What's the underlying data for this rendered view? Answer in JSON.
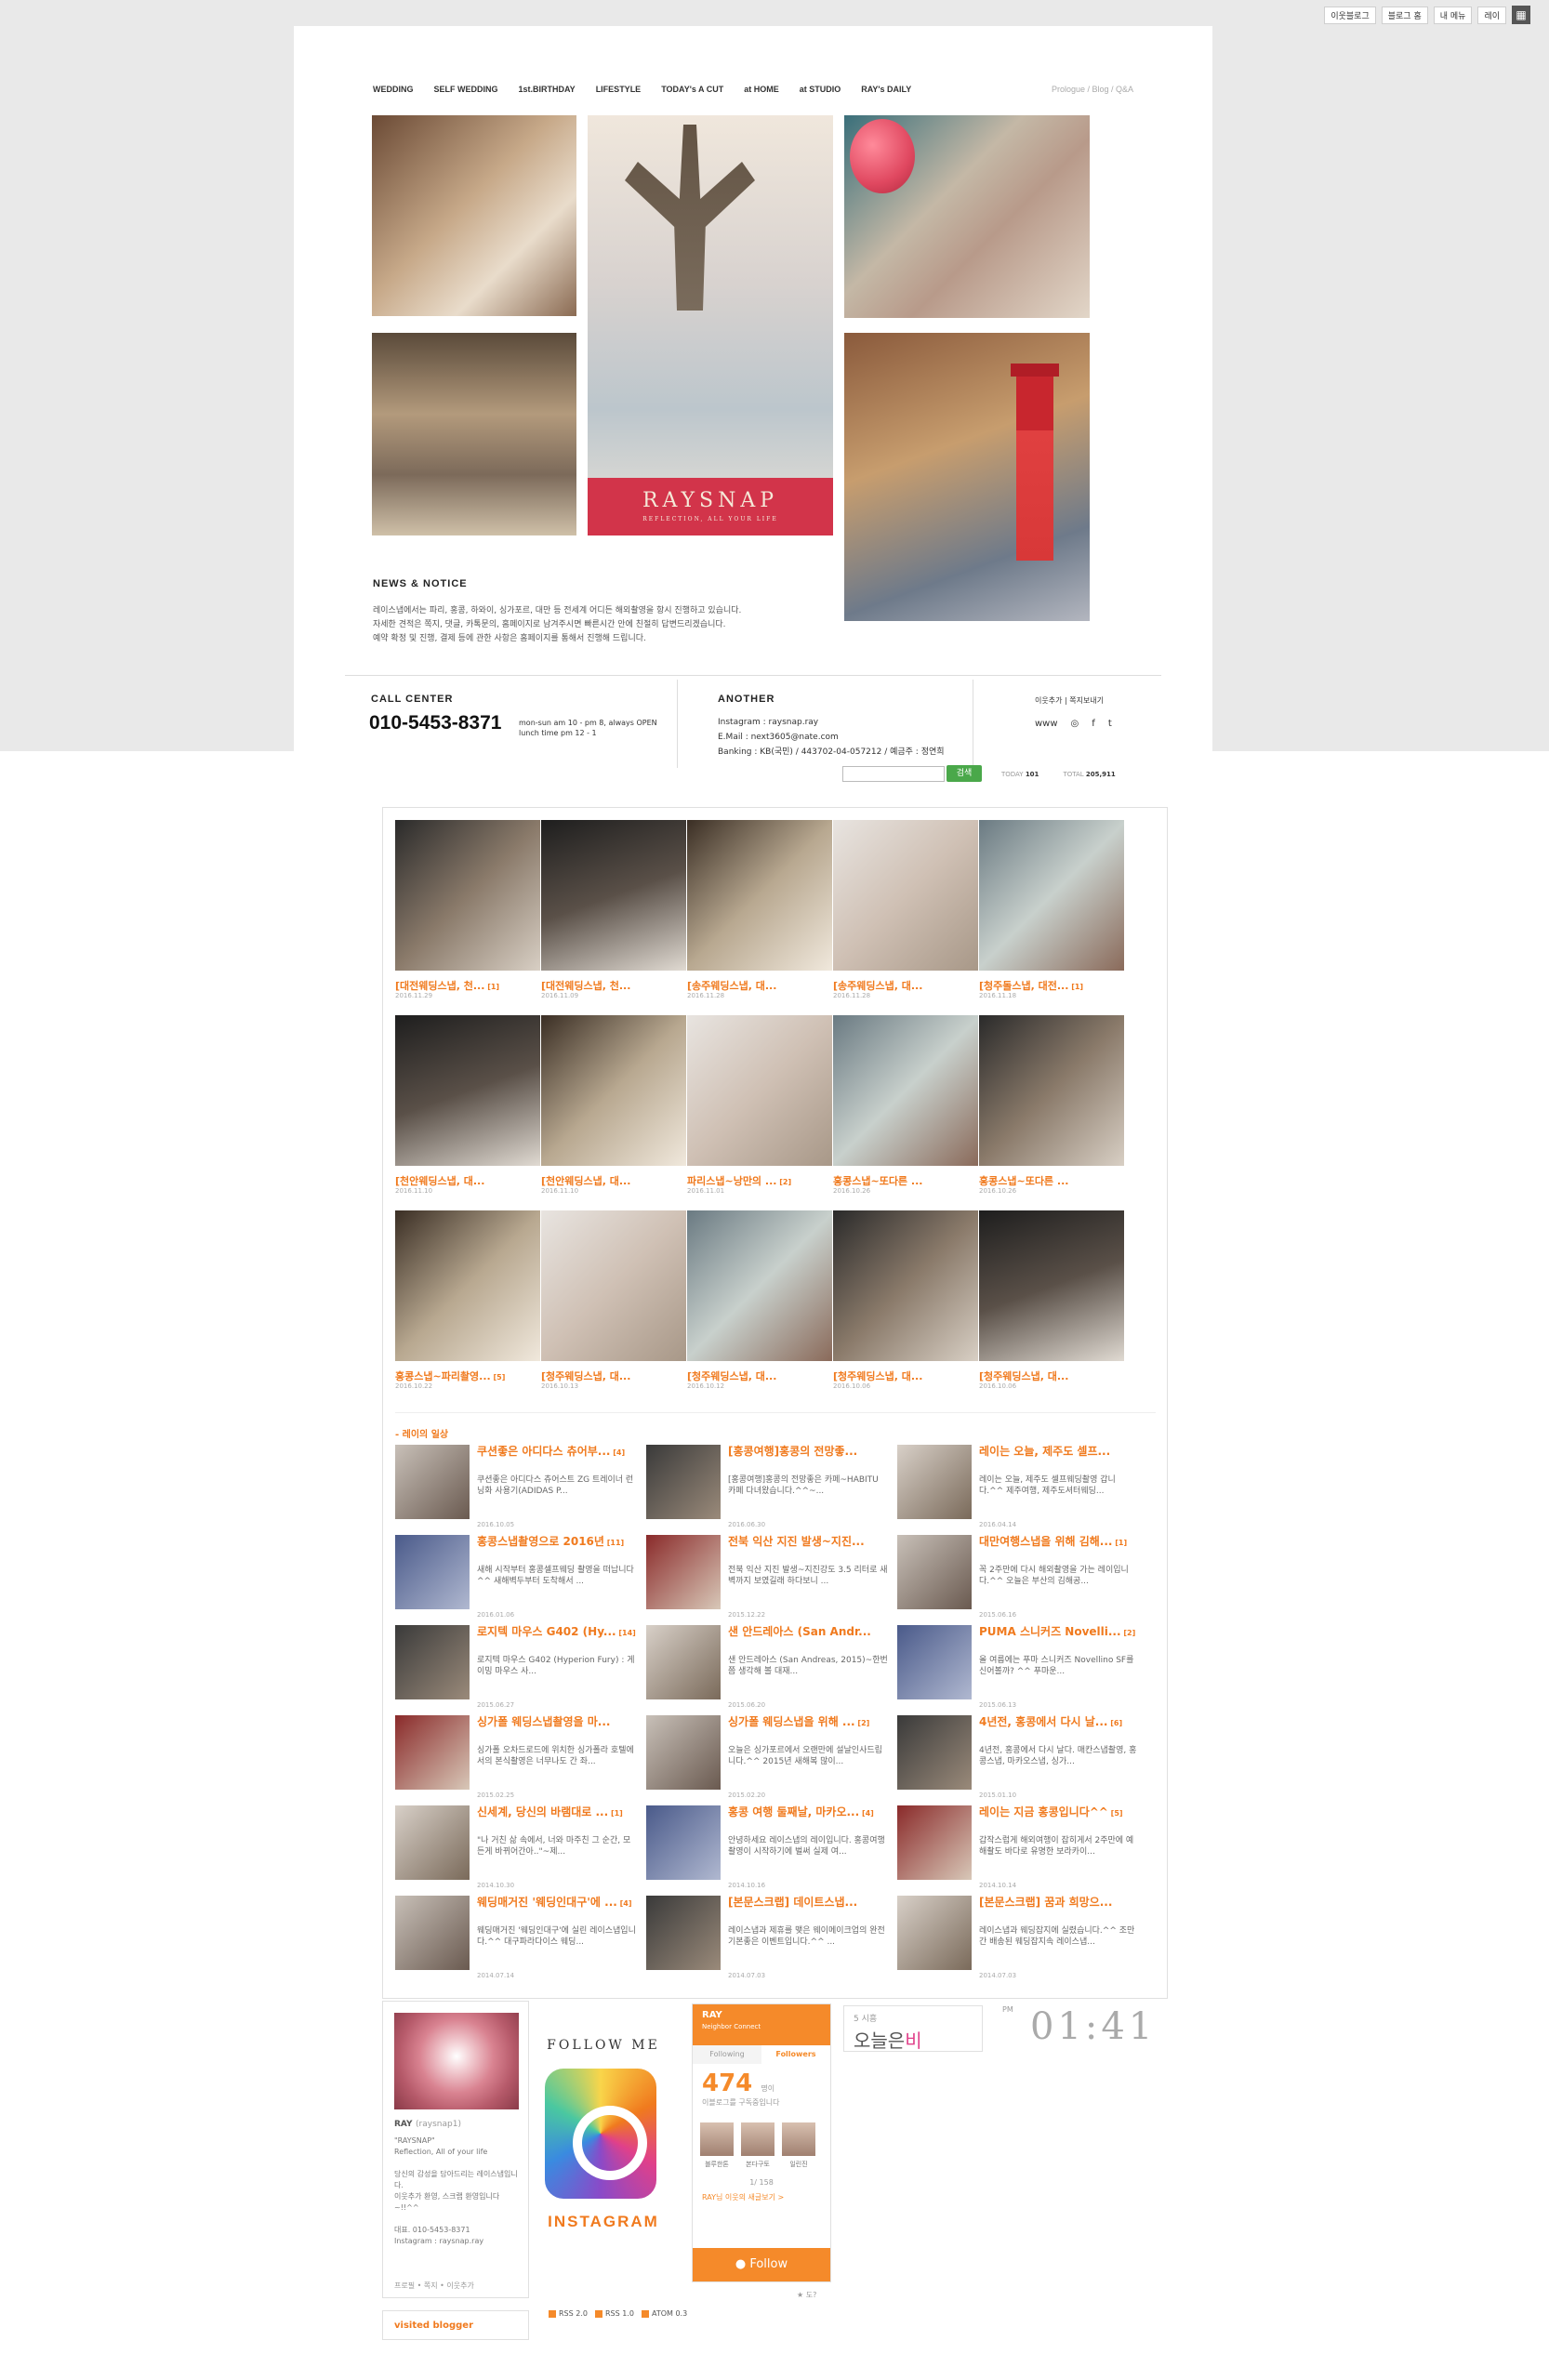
{
  "utilbar": {
    "items": [
      "이웃블로그",
      "블로그 홈",
      "내 메뉴",
      "레이"
    ]
  },
  "nav": {
    "items": [
      "WEDDING",
      "SELF WEDDING",
      "1st.BIRTHDAY",
      "LIFESTYLE",
      "TODAY's A CUT",
      "at HOME",
      "at STUDIO",
      "RAY's DAILY"
    ],
    "right": "Prologue / Blog / Q&A"
  },
  "hero": {
    "brand": "RAYSNAP",
    "tagline": "REFLECTION, ALL YOUR LIFE"
  },
  "news": {
    "title": "NEWS & NOTICE",
    "lines": [
      "레이스냅에서는 파리, 홍콩, 하와이, 싱가포르, 대만 등 전세계 어디든 해외촬영을 항시 진행하고 있습니다.",
      "자세한 견적은 쪽지, 댓글, 카톡문의, 홈페이지로 남겨주시면 빠른시간 안에 친절히 답변드리겠습니다.",
      "예약 확정 및 진행, 결제 등에 관한 사항은 홈페이지를 통해서 진행해 드립니다."
    ]
  },
  "call": {
    "title": "CALL CENTER",
    "number": "010-5453-8371",
    "hours1": "mon-sun am 10 - pm 8, always OPEN",
    "hours2": "lunch time pm 12 - 1"
  },
  "another": {
    "title": "ANOTHER",
    "instagram": "Instagram : raysnap.ray",
    "email": "E.Mail : next3605@nate.com",
    "banking": "Banking : KB(국민) / 443702-04-057212 / 예금주 : 정연희"
  },
  "neighbor_links": "이웃추가 | 쪽지보내기",
  "sns": [
    "www",
    "◎",
    "f",
    "t"
  ],
  "search": {
    "button": "검색",
    "today_label": "TODAY",
    "today": "101",
    "total_label": "TOTAL",
    "total": "205,911"
  },
  "posts": [
    {
      "title": "[대전웨딩스냅, 천...",
      "count": "[1]",
      "date": "2016.11.29"
    },
    {
      "title": "[대전웨딩스냅, 천...",
      "count": "",
      "date": "2016.11.09"
    },
    {
      "title": "[송주웨딩스냅, 대...",
      "count": "",
      "date": "2016.11.28"
    },
    {
      "title": "[송주웨딩스냅, 대...",
      "count": "",
      "date": "2016.11.28"
    },
    {
      "title": "[청주돌스냅, 대전...",
      "count": "[1]",
      "date": "2016.11.18"
    },
    {
      "title": "[천안웨딩스냅, 대...",
      "count": "",
      "date": "2016.11.10"
    },
    {
      "title": "[천안웨딩스냅, 대...",
      "count": "",
      "date": "2016.11.10"
    },
    {
      "title": "파리스냅~낭만의 ...",
      "count": "[2]",
      "date": "2016.11.01"
    },
    {
      "title": "홍콩스냅~또다른 ...",
      "count": "",
      "date": "2016.10.26"
    },
    {
      "title": "홍콩스냅~또다른 ...",
      "count": "",
      "date": "2016.10.26"
    },
    {
      "title": "홍콩스냅~파리촬영...",
      "count": "[5]",
      "date": "2016.10.22"
    },
    {
      "title": "[청주웨딩스냅, 대...",
      "count": "",
      "date": "2016.10.13"
    },
    {
      "title": "[청주웨딩스냅, 대...",
      "count": "",
      "date": "2016.10.12"
    },
    {
      "title": "[청주웨딩스냅, 대...",
      "count": "",
      "date": "2016.10.06"
    },
    {
      "title": "[청주웨딩스냅, 대...",
      "count": "",
      "date": "2016.10.06"
    }
  ],
  "daily": {
    "section_title": "- 레이의 일상",
    "items": [
      {
        "title": "쿠션좋은 아디다스 츄어부...",
        "count": "[4]",
        "desc": "쿠션좋은 아디다스 츄어스트 ZG 트레이너 런닝화 사용기(ADIDAS P...",
        "date": "2016.10.05"
      },
      {
        "title": "[홍콩여행]홍콩의 전망좋...",
        "count": "",
        "desc": "[홍콩여행]홍콩의 전망좋은 카페~HABITU 카페 다녀왔습니다.^^~...",
        "date": "2016.06.30"
      },
      {
        "title": "레이는 오늘, 제주도 셀프...",
        "count": "",
        "desc": "레이는 오늘, 제주도 셀프웨딩촬영 갑니다.^^ 제주여행, 제주도셔터웨딩...",
        "date": "2016.04.14"
      },
      {
        "title": "홍콩스냅촬영으로 2016년",
        "count": "[11]",
        "desc": "새해 시작부터 홍콩셀프웨딩 촬영을 떠납니다^^ 새해벽두부터 도착해서 ...",
        "date": "2016.01.06"
      },
      {
        "title": "전북 익산 지진 발생~지진...",
        "count": "",
        "desc": "전북 익산 지진 발생~지진강도 3.5 리터로 새벽까지 보였길래 하다보니 ...",
        "date": "2015.12.22"
      },
      {
        "title": "대만여행스냅을 위해 김해...",
        "count": "[1]",
        "desc": "꼭 2주만에 다시 해외촬영을 가는 레이입니다.^^ 오늘은 부산의 김해공...",
        "date": "2015.06.16"
      },
      {
        "title": "로지텍 마우스 G402 (Hy...",
        "count": "[14]",
        "desc": "로지텍 마우스 G402 (Hyperion Fury) : 게이밍 마우스 사...",
        "date": "2015.06.27"
      },
      {
        "title": "샌 안드레아스 (San Andr...",
        "count": "",
        "desc": "샌 안드레아스 (San Andreas, 2015)~한번쯤 생각해 볼 대재...",
        "date": "2015.06.20"
      },
      {
        "title": "PUMA 스니커즈 Novelli...",
        "count": "[2]",
        "desc": "올 여름에는 푸마 스니커즈 Novellino SF를 신어볼까? ^^ 푸마운...",
        "date": "2015.06.13"
      },
      {
        "title": "싱가폴 웨딩스냅촬영을 마...",
        "count": "",
        "desc": "싱가폴 오차드로드에 위치한 싱가폴라 호텔에서의 본식촬영은 너무나도 간 좌...",
        "date": "2015.02.25"
      },
      {
        "title": "싱가폴 웨딩스냅을 위해 ...",
        "count": "[2]",
        "desc": "오늘은 싱가포르에서 오랜만에 설날인사드립니다.^^ 2015년 새해복 많이...",
        "date": "2015.02.20"
      },
      {
        "title": "4년전, 홍콩에서 다시 날...",
        "count": "[6]",
        "desc": "4년전, 홍콩에서 다시 날다. 매칸스냅촬영, 홍콩스냅, 마카오스냅, 싱가...",
        "date": "2015.01.10"
      },
      {
        "title": "신세계, 당신의 바램대로 ...",
        "count": "[1]",
        "desc": "\"나 거친 삶 속에서, 너와 마주친 그 순간, 모든게 바뀌어간아..\"~제...",
        "date": "2014.10.30"
      },
      {
        "title": "홍콩 여행 둘째날, 마카오...",
        "count": "[4]",
        "desc": "안녕하세요 레이스냅의 레이입니다. 홍콩여행촬영이 시작하기에 벌써 실제 여...",
        "date": "2014.10.16"
      },
      {
        "title": "레이는 지금 홍콩입니다^^",
        "count": "[5]",
        "desc": "갑작스럽게 해외여행이 잡히게서 2주만에 예해촬도 바다로 유명한 보라카이...",
        "date": "2014.10.14"
      },
      {
        "title": "웨딩매거진 '웨딩인대구'에 ...",
        "count": "[4]",
        "desc": "웨딩매거진 '웨딩인대구'에 실린 레이스냅입니다.^^ 대구파라다이스 웨딩...",
        "date": "2014.07.14"
      },
      {
        "title": "[본문스크랩] 데이트스냅...",
        "count": "",
        "desc": "레이스냅과 제휴를 맺은 웨이메이크업의 완전 기본좋은 이벤트입니다.^^ ...",
        "date": "2014.07.03"
      },
      {
        "title": "[본문스크랩] 꿈과 희망으...",
        "count": "",
        "desc": "레이스냅과 웨딩잡지에 실렸습니다.^^ 조만간 배송된 웨딩잡지속 레이스냅...",
        "date": "2014.07.03"
      }
    ]
  },
  "profile": {
    "name": "RAY",
    "id": "(raysnap1)",
    "lines": [
      "\"RAYSNAP\"",
      "Reflection, All of your life",
      "",
      "당신의 감성을 담아드리는 레이스냅입니다.",
      "이웃추가 환영, 스크랩 환영입니다~!!^^",
      "",
      "대표. 010-5453-8371",
      "Instagram : raysnap.ray"
    ],
    "footer": "프로필 • 쪽지 • 이웃추가"
  },
  "visited": "visited blogger",
  "instagram_widget": {
    "follow": "FOLLOW ME",
    "label": "INSTAGRAM"
  },
  "neighbor_widget": {
    "name": "RAY",
    "sub": "Neighbor Connect",
    "tab1": "Following",
    "tab2": "Followers",
    "count": "474",
    "unit": "명이",
    "subtitle": "이블로그를 구독중입니다",
    "avatars": [
      "블루한톤",
      "본다구토",
      "일린진"
    ],
    "page": "1/ 158",
    "more": "RAY님 이웃의 새글보기 >",
    "button": "Follow",
    "note": "★ 도?"
  },
  "weather": {
    "top": "5 시흥",
    "label": "오늘은",
    "word": "비"
  },
  "clock": {
    "ampm": "PM",
    "time": "01:41"
  },
  "rss": [
    "RSS 2.0",
    "RSS 1.0",
    "ATOM 0.3"
  ]
}
